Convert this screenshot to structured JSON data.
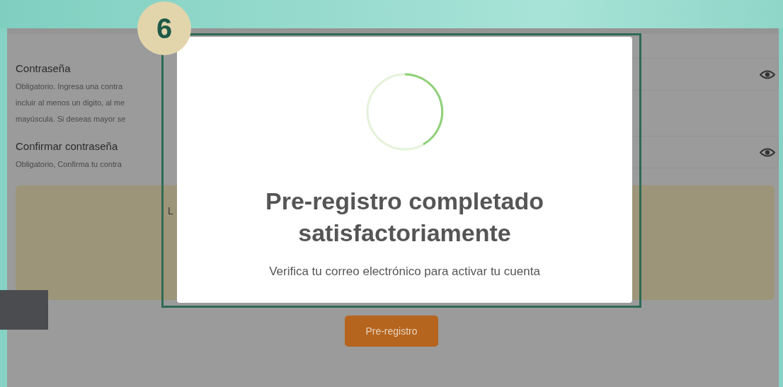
{
  "tutorial": {
    "step_badge": "6"
  },
  "form": {
    "fields": [
      {
        "label": "Contraseña",
        "help_lines": [
          "Obligatorio. Ingresa una contra",
          "incluir al menos un digito, al me",
          "mayúscula. Si deseas mayor se"
        ]
      },
      {
        "label": "Confirmar contraseña",
        "help_lines": [
          "Obligatorio, Confirma tu contra"
        ]
      }
    ],
    "notice": {
      "text": "L"
    },
    "submit_button": "Pre-registro"
  },
  "modal": {
    "title": "Pre-registro completado satisfactoriamente",
    "message": "Verifica tu correo electrónico para activar tu cuenta"
  }
}
